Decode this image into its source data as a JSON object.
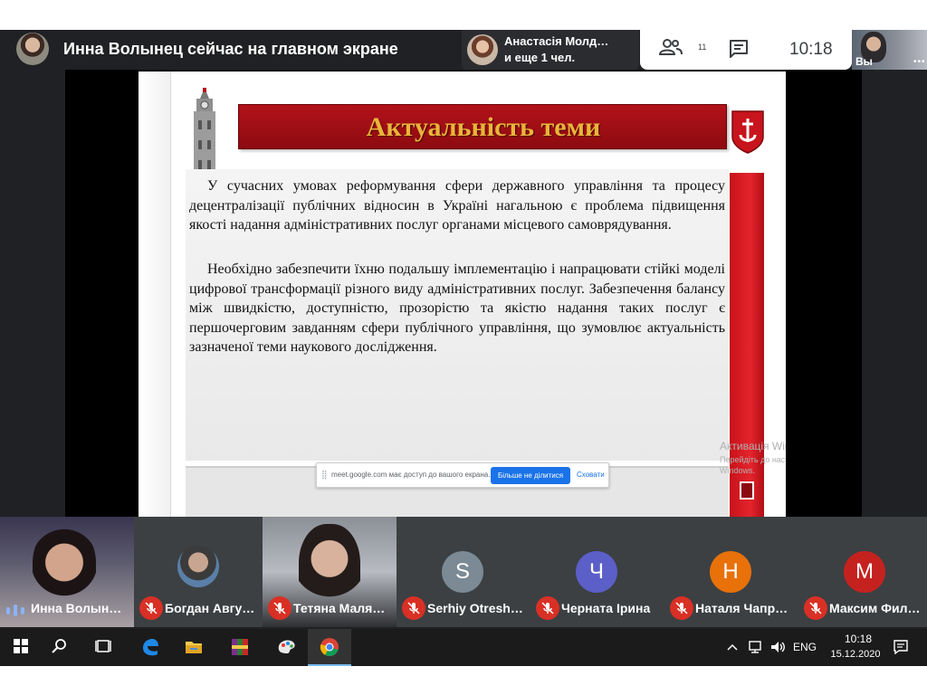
{
  "top_bar": {
    "presenter_title": "Инна Волынец сейчас на главном экране",
    "participant_chip": {
      "name": "Анастасія Молд…",
      "more": "и еще 1 чел."
    },
    "people_count": "11",
    "clock": "10:18",
    "self_label": "Вы",
    "self_more": "•••"
  },
  "slide": {
    "title": "Актуальність теми",
    "paragraph_1": "У сучасних умовах реформування сфери державного управління та процесу децентралізації публічних відносин в Україні нагальною є проблема підвищення якості надання адміністративних послуг органами місцевого самоврядування.",
    "paragraph_2": "Необхідно забезпечити їхню подальшу імплементацію і напрацювати стійкі моделі цифрової трансформації різного виду адміністративних послуг. Забезпечення балансу між швидкістю, доступністю, прозорістю та якістю надання таких послуг є першочерговим завданням сфери публічного управління, що зумовлює актуальність зазначеної теми наукового дослідження.",
    "share_bar": {
      "handle": "⣿",
      "text": "meet.google.com має доступ до вашого екрана.",
      "stop_label": "Більше не ділитися",
      "hide_label": "Сховати"
    },
    "watermark_title": "Активація Windows",
    "watermark_sub": "Перейдіть до настройок ПК, щоб активувати Windows."
  },
  "tiles": [
    {
      "name": "Инна Волын…",
      "type": "photo",
      "muted": false
    },
    {
      "name": "Богдан Авгу…",
      "type": "photo-avatar",
      "muted": true
    },
    {
      "name": "Тетяна Маля…",
      "type": "photo",
      "muted": true
    },
    {
      "name": "Serhiy Otresh…",
      "type": "letter",
      "letter": "S",
      "color": "#7b8a94",
      "muted": true
    },
    {
      "name": "Черната Ірина",
      "type": "letter",
      "letter": "Ч",
      "color": "#5b5fc7",
      "muted": true
    },
    {
      "name": "Наталя Чапр…",
      "type": "letter",
      "letter": "Н",
      "color": "#e8710a",
      "muted": true
    },
    {
      "name": "Максим Фил…",
      "type": "letter",
      "letter": "М",
      "color": "#c5221f",
      "muted": true
    }
  ],
  "taskbar": {
    "icons": [
      "windows-start-icon",
      "search-icon",
      "task-view-icon",
      "edge-icon",
      "file-explorer-icon",
      "winrar-icon",
      "paint-icon",
      "chrome-icon"
    ],
    "language": "ENG",
    "time": "10:18",
    "date": "15.12.2020"
  },
  "colors": {
    "meet_bg": "#202124",
    "slide_red": "#b3121a",
    "title_gold": "#e9b53b",
    "share_blue": "#1a73e8",
    "mic_off_red": "#d93025"
  }
}
